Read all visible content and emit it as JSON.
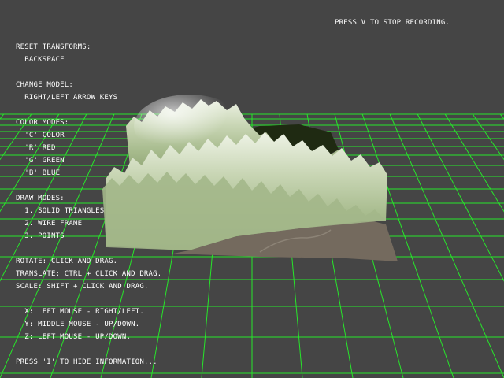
{
  "recording_status": "PRESS V TO STOP RECORDING.",
  "help": [
    "RESET TRANSFORMS:",
    "  BACKSPACE",
    "",
    "CHANGE MODEL:",
    "  RIGHT/LEFT ARROW KEYS",
    "",
    "COLOR MODES:",
    "  'C' COLOR",
    "  'R' RED",
    "  'G' GREEN",
    "  'B' BLUE",
    "",
    "DRAW MODES:",
    "  1. SOLID TRIANGLES",
    "  2. WIRE FRAME",
    "  3. POINTS",
    "",
    "ROTATE: CLICK AND DRAG.",
    "TRANSLATE: CTRL + CLICK AND DRAG.",
    "SCALE: SHIFT + CLICK AND DRAG.",
    "",
    "  X: LEFT MOUSE - RIGHT/LEFT.",
    "  Y: MIDDLE MOUSE - UP/DOWN.",
    "  Z: LEFT MOUSE - UP/DOWN.",
    "",
    "PRESS 'I' TO HIDE INFORMATION..."
  ],
  "colors": {
    "background": "#454545",
    "grid": "#27e62a",
    "text": "#ffffff",
    "terrain_light": "#e4edd6",
    "terrain_mid": "#a4b98a",
    "terrain_shadow": "#1f2a12",
    "ground": "#746a5e"
  }
}
